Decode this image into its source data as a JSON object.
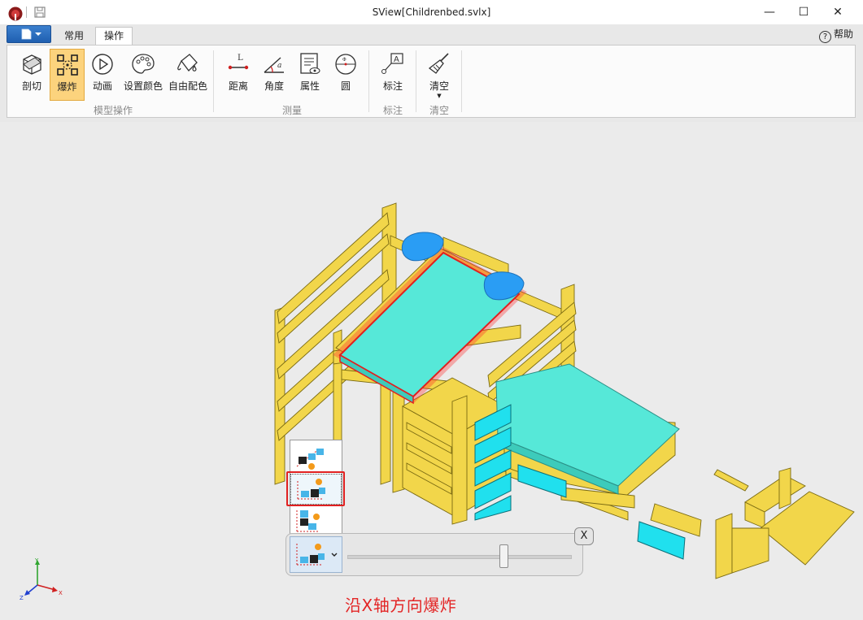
{
  "window": {
    "title": "SView[Childrenbed.svlx]",
    "minimize": "—",
    "maximize": "☐",
    "close": "✕"
  },
  "tabs": [
    {
      "label": "常用",
      "active": false
    },
    {
      "label": "操作",
      "active": true
    }
  ],
  "help": {
    "icon": "?",
    "label": "帮助"
  },
  "ribbon": {
    "groups": [
      {
        "label": "模型操作",
        "buttons": [
          {
            "label": "剖切",
            "icon": "section-cube-icon"
          },
          {
            "label": "爆炸",
            "icon": "explode-icon",
            "active": true
          },
          {
            "label": "动画",
            "icon": "play-circle-icon"
          },
          {
            "label": "设置颜色",
            "icon": "palette-icon"
          },
          {
            "label": "自由配色",
            "icon": "paint-bucket-icon"
          }
        ]
      },
      {
        "label": "测量",
        "buttons": [
          {
            "label": "距离",
            "icon": "distance-icon",
            "glyph": "L"
          },
          {
            "label": "角度",
            "icon": "angle-icon",
            "glyph": "a"
          },
          {
            "label": "属性",
            "icon": "properties-icon"
          },
          {
            "label": "圆",
            "icon": "circle-measure-icon"
          }
        ]
      },
      {
        "label": "标注",
        "buttons": [
          {
            "label": "标注",
            "icon": "annotation-icon",
            "glyph": "A"
          }
        ]
      },
      {
        "label": "清空",
        "buttons": [
          {
            "label": "清空",
            "icon": "broom-icon",
            "dropdown": true
          }
        ]
      }
    ]
  },
  "explode_panel": {
    "options": [
      {
        "name": "explode-free-direction",
        "selected": false
      },
      {
        "name": "explode-x-axis",
        "selected": true
      },
      {
        "name": "explode-y-axis",
        "selected": false
      }
    ],
    "slider_value": 0.7,
    "close_label": "X"
  },
  "axis": {
    "x": "X",
    "y": "Y",
    "z": "Z"
  },
  "caption": "沿X轴方向爆炸",
  "colors": {
    "accent": "#fcd37d",
    "wood": "#f2d64a",
    "mattress": "#56e8d8",
    "drawer": "#20e0ee",
    "pillow": "#2a9df4",
    "highlight": "#e02020"
  }
}
